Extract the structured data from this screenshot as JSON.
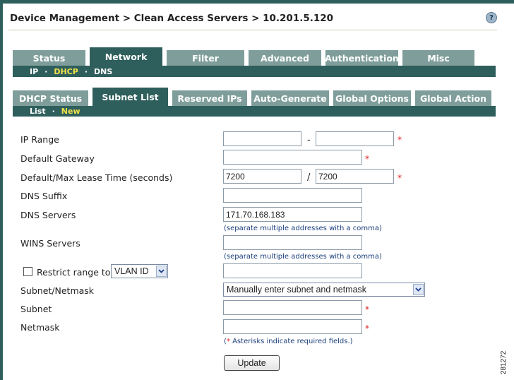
{
  "header": {
    "breadcrumb": "Device Management > Clean Access Servers > 10.201.5.120",
    "help_glyph": "?"
  },
  "main_tabs": [
    {
      "label": "Status",
      "active": false
    },
    {
      "label": "Network",
      "active": true
    },
    {
      "label": "Filter",
      "active": false
    },
    {
      "label": "Advanced",
      "active": false
    },
    {
      "label": "Authentication",
      "active": false
    },
    {
      "label": "Misc",
      "active": false
    }
  ],
  "network_subnav": {
    "items": [
      "IP",
      "DHCP",
      "DNS"
    ],
    "current": "DHCP",
    "sep": "·"
  },
  "dhcp_tabs": [
    {
      "label": "DHCP Status",
      "active": false
    },
    {
      "label": "Subnet List",
      "active": true
    },
    {
      "label": "Reserved IPs",
      "active": false
    },
    {
      "label": "Auto-Generate",
      "active": false
    },
    {
      "label": "Global Options",
      "active": false
    },
    {
      "label": "Global Action",
      "active": false
    }
  ],
  "subnet_subnav": {
    "items": [
      "List",
      "New"
    ],
    "current": "New",
    "sep": "·"
  },
  "form": {
    "ip_range": {
      "label": "IP Range",
      "start": "",
      "end": "",
      "dash": "-"
    },
    "default_gateway": {
      "label": "Default Gateway",
      "value": ""
    },
    "lease_time": {
      "label": "Default/Max Lease Time (seconds)",
      "default": "7200",
      "max": "7200",
      "slash": "/"
    },
    "dns_suffix": {
      "label": "DNS Suffix",
      "value": ""
    },
    "dns_servers": {
      "label": "DNS Servers",
      "value": "171.70.168.183",
      "hint": "(separate multiple addresses with a comma)"
    },
    "wins_servers": {
      "label": "WINS Servers",
      "value": "",
      "hint": "(separate multiple addresses with a comma)"
    },
    "restrict_range": {
      "label": "Restrict range to",
      "checked": false,
      "select_value": "VLAN ID",
      "value": ""
    },
    "subnet_netmask": {
      "label": "Subnet/Netmask",
      "select_value": "Manually enter subnet and netmask"
    },
    "subnet": {
      "label": "Subnet",
      "value": ""
    },
    "netmask": {
      "label": "Netmask",
      "value": ""
    },
    "required_star": "*",
    "required_note": "Asterisks indicate required fields.)",
    "required_note_prefix": "(",
    "update_label": "Update"
  },
  "figure_id": "281272",
  "colors": {
    "tab_active": "#2e5f5c",
    "tab_inactive": "#7f9e9b",
    "current_item": "#f2e24a",
    "required": "#dd2222",
    "hint": "#1a3d7a"
  }
}
